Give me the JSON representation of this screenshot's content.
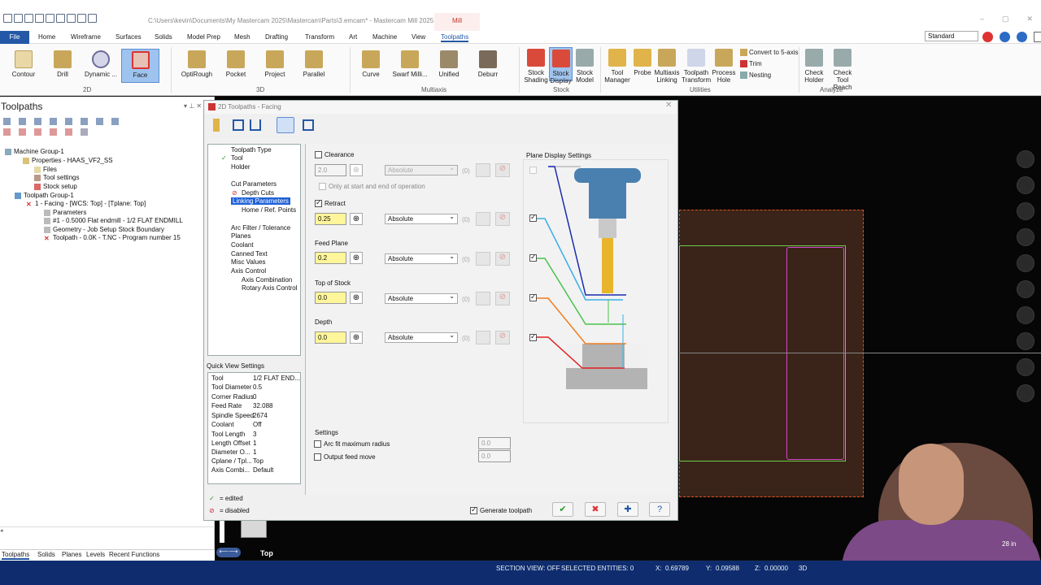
{
  "app": {
    "title": "C:\\Users\\kevin\\Documents\\My Mastercam 2025\\Mastercam\\Parts\\3.emcam* - Mastercam Mill 2025",
    "context_tab": "Mill"
  },
  "menu": {
    "file": "File",
    "tabs": [
      "Home",
      "Wireframe",
      "Surfaces",
      "Solids",
      "Model Prep",
      "Mesh",
      "Drafting",
      "Transform",
      "Art",
      "Machine",
      "View",
      "Toolpaths"
    ],
    "workspace": "Standard"
  },
  "ribbon": {
    "g2d": {
      "label": "2D",
      "items": [
        "Contour",
        "Drill",
        "Dynamic ...",
        "Face"
      ]
    },
    "g3d": {
      "label": "3D",
      "items": [
        "OptiRough",
        "Pocket",
        "Project",
        "Parallel"
      ]
    },
    "multi": {
      "label": "Multiaxis",
      "items": [
        "Curve",
        "Swarf Milli...",
        "Unified",
        "Deburr"
      ]
    },
    "stock": {
      "label": "Stock",
      "items": [
        "Stock Shading",
        "Stock Display",
        "Stock Model"
      ]
    },
    "util": {
      "label": "Utilities",
      "items": [
        "Tool Manager",
        "Probe",
        "Multiaxis Linking",
        "Toolpath Transform",
        "Process Hole"
      ],
      "small": [
        "Convert to 5-axis",
        "Trim",
        "Nesting"
      ]
    },
    "analyze": {
      "label": "Analyze",
      "items": [
        "Check Holder",
        "Check Tool Reach"
      ]
    }
  },
  "left_panel": {
    "title": "Toolpaths",
    "tree": [
      "Machine Group-1",
      "Properties - HAAS_VF2_SS",
      "Files",
      "Tool settings",
      "Stock setup",
      "Toolpath Group-1",
      "1 - Facing - [WCS: Top] - [Tplane: Top]",
      "Parameters",
      "#1 - 0.5000 Flat endmill - 1/2 FLAT ENDMILL",
      "Geometry - Job Setup Stock Boundary",
      "Toolpath - 0.0K - T.NC - Program number 15"
    ],
    "tabs": [
      "Toolpaths",
      "Solids",
      "Planes",
      "Levels",
      "Recent Functions"
    ]
  },
  "dialog": {
    "title": "2D Toolpaths - Facing",
    "nav": [
      "Toolpath Type",
      "Tool",
      "Holder",
      "Cut Parameters",
      "Depth Cuts",
      "Linking Parameters",
      "Home / Ref. Points",
      "Arc Filter / Tolerance",
      "Planes",
      "Coolant",
      "Canned Text",
      "Misc Values",
      "Axis Control",
      "Axis Combination",
      "Rotary Axis Control"
    ],
    "quick_view_title": "Quick View Settings",
    "quick_view": [
      [
        "Tool",
        "1/2 FLAT END..."
      ],
      [
        "Tool Diameter",
        "0.5"
      ],
      [
        "Corner Radius",
        "0"
      ],
      [
        "Feed Rate",
        "32.088"
      ],
      [
        "Spindle Speed",
        "2674"
      ],
      [
        "Coolant",
        "Off"
      ],
      [
        "Tool Length",
        "3"
      ],
      [
        "Length Offset",
        "1"
      ],
      [
        "Diameter O...",
        "1"
      ],
      [
        "Cplane / Tpl...",
        "Top"
      ],
      [
        "Axis Combi...",
        "Default"
      ]
    ],
    "legend_edited": "= edited",
    "legend_disabled": "= disabled",
    "params": {
      "clearance": {
        "label": "Clearance",
        "value": "2.0",
        "mode": "Absolute",
        "idx": "(0)",
        "sub": "Only at start and end of operation"
      },
      "retract": {
        "label": "Retract",
        "value": "0.25",
        "mode": "Absolute",
        "idx": "(0)"
      },
      "feed": {
        "label": "Feed Plane",
        "value": "0.2",
        "mode": "Absolute",
        "idx": "(0)"
      },
      "top": {
        "label": "Top of Stock",
        "value": "0.0",
        "mode": "Absolute",
        "idx": "(0)"
      },
      "depth": {
        "label": "Depth",
        "value": "0.0",
        "mode": "Absolute",
        "idx": "(0)"
      }
    },
    "plane_display": "Plane Display Settings",
    "settings": {
      "title": "Settings",
      "arc_fit": "Arc fit maximum radius",
      "arc_val": "0.0",
      "output_feed": "Output feed move",
      "feed_val": "0.0"
    },
    "generate": "Generate toolpath"
  },
  "viewport": {
    "view": "Top",
    "scale": "28 in"
  },
  "status": {
    "section": "SECTION VIEW: OFF",
    "selected": "SELECTED ENTITIES: 0",
    "x_label": "X:",
    "x": "0.69789",
    "y_label": "Y:",
    "y": "0.09588",
    "z_label": "Z:",
    "z": "0.00000",
    "mode": "3D"
  },
  "colors": {
    "accent": "#2458a6",
    "selection": "#1e61d6",
    "input_yellow": "#fff59a",
    "status_bg": "#0f2d6e"
  }
}
